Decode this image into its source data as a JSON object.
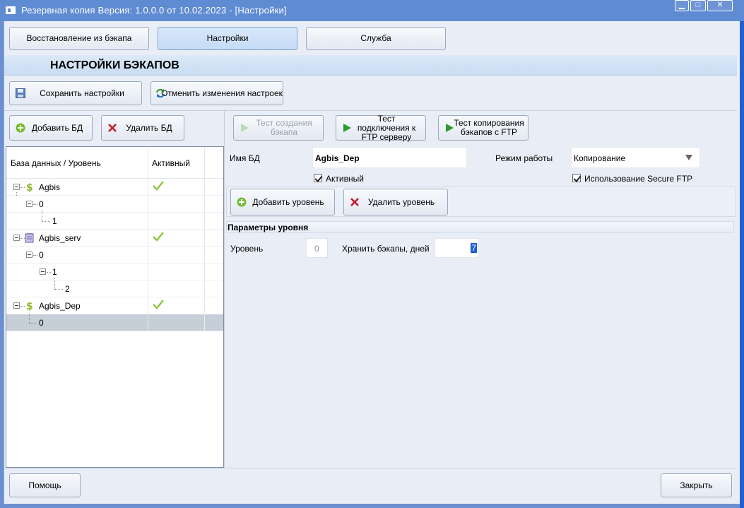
{
  "window": {
    "title": "Резервная копия   Версия: 1.0.0.0 от 10.02.2023 - [Настройки]",
    "minimize": "▁",
    "maximize": "□",
    "close": "✕"
  },
  "tabs": [
    {
      "label": "Восстановление из бэкапа",
      "active": false
    },
    {
      "label": "Настройки",
      "active": true
    },
    {
      "label": "Служба",
      "active": false
    }
  ],
  "section_title": "НАСТРОЙКИ БЭКАПОВ",
  "toolbar": {
    "save_label": "Сохранить настройки",
    "revert_label": "Отменить изменения настроек"
  },
  "db_buttons": {
    "add_label": "Добавить БД",
    "delete_label": "Удалить БД"
  },
  "test_buttons": {
    "create_label": "Тест создания бэкапа",
    "ftp_connect_label": "Тест подключения к FTP серверу",
    "ftp_copy_label": "Тест копирования бэкапов с FTP"
  },
  "tree": {
    "col_db": "База данных / Уровень",
    "col_active": "Активный",
    "rows": [
      {
        "text": "Agbis",
        "level": 0,
        "icon": "dollar-db-icon",
        "active": true
      },
      {
        "text": "0",
        "level": 1
      },
      {
        "text": "1",
        "level": 2
      },
      {
        "text": "Agbis_serv",
        "level": 0,
        "icon": "server-db-icon",
        "active": true
      },
      {
        "text": "0",
        "level": 1
      },
      {
        "text": "1",
        "level": 2
      },
      {
        "text": "2",
        "level": 3
      },
      {
        "text": "Agbis_Dep",
        "level": 0,
        "icon": "dollar-db-icon",
        "active": true
      },
      {
        "text": "0",
        "level": 1,
        "selected": true
      }
    ]
  },
  "form": {
    "db_name_label": "Имя БД",
    "db_name_value": "Agbis_Dep",
    "mode_label": "Режим работы",
    "mode_value": "Копирование",
    "active_label": "Активный",
    "secure_ftp_label": "Использование Secure FTP"
  },
  "level_buttons": {
    "add_label": "Добавить уровень",
    "delete_label": "Удалить уровень"
  },
  "level_params": {
    "title": "Параметры уровня",
    "level_label": "Уровень",
    "level_value": "0",
    "keep_label": "Хранить бэкапы, дней",
    "keep_value": "7"
  },
  "footer": {
    "help_label": "Помощь",
    "close_label": "Закрыть"
  },
  "colors": {
    "titlebar": "#5f8bd3",
    "window_bg": "#e9eef6",
    "accent_green": "#7dc03a",
    "delete_red": "#c8182a",
    "selection": "#c6ced8"
  }
}
